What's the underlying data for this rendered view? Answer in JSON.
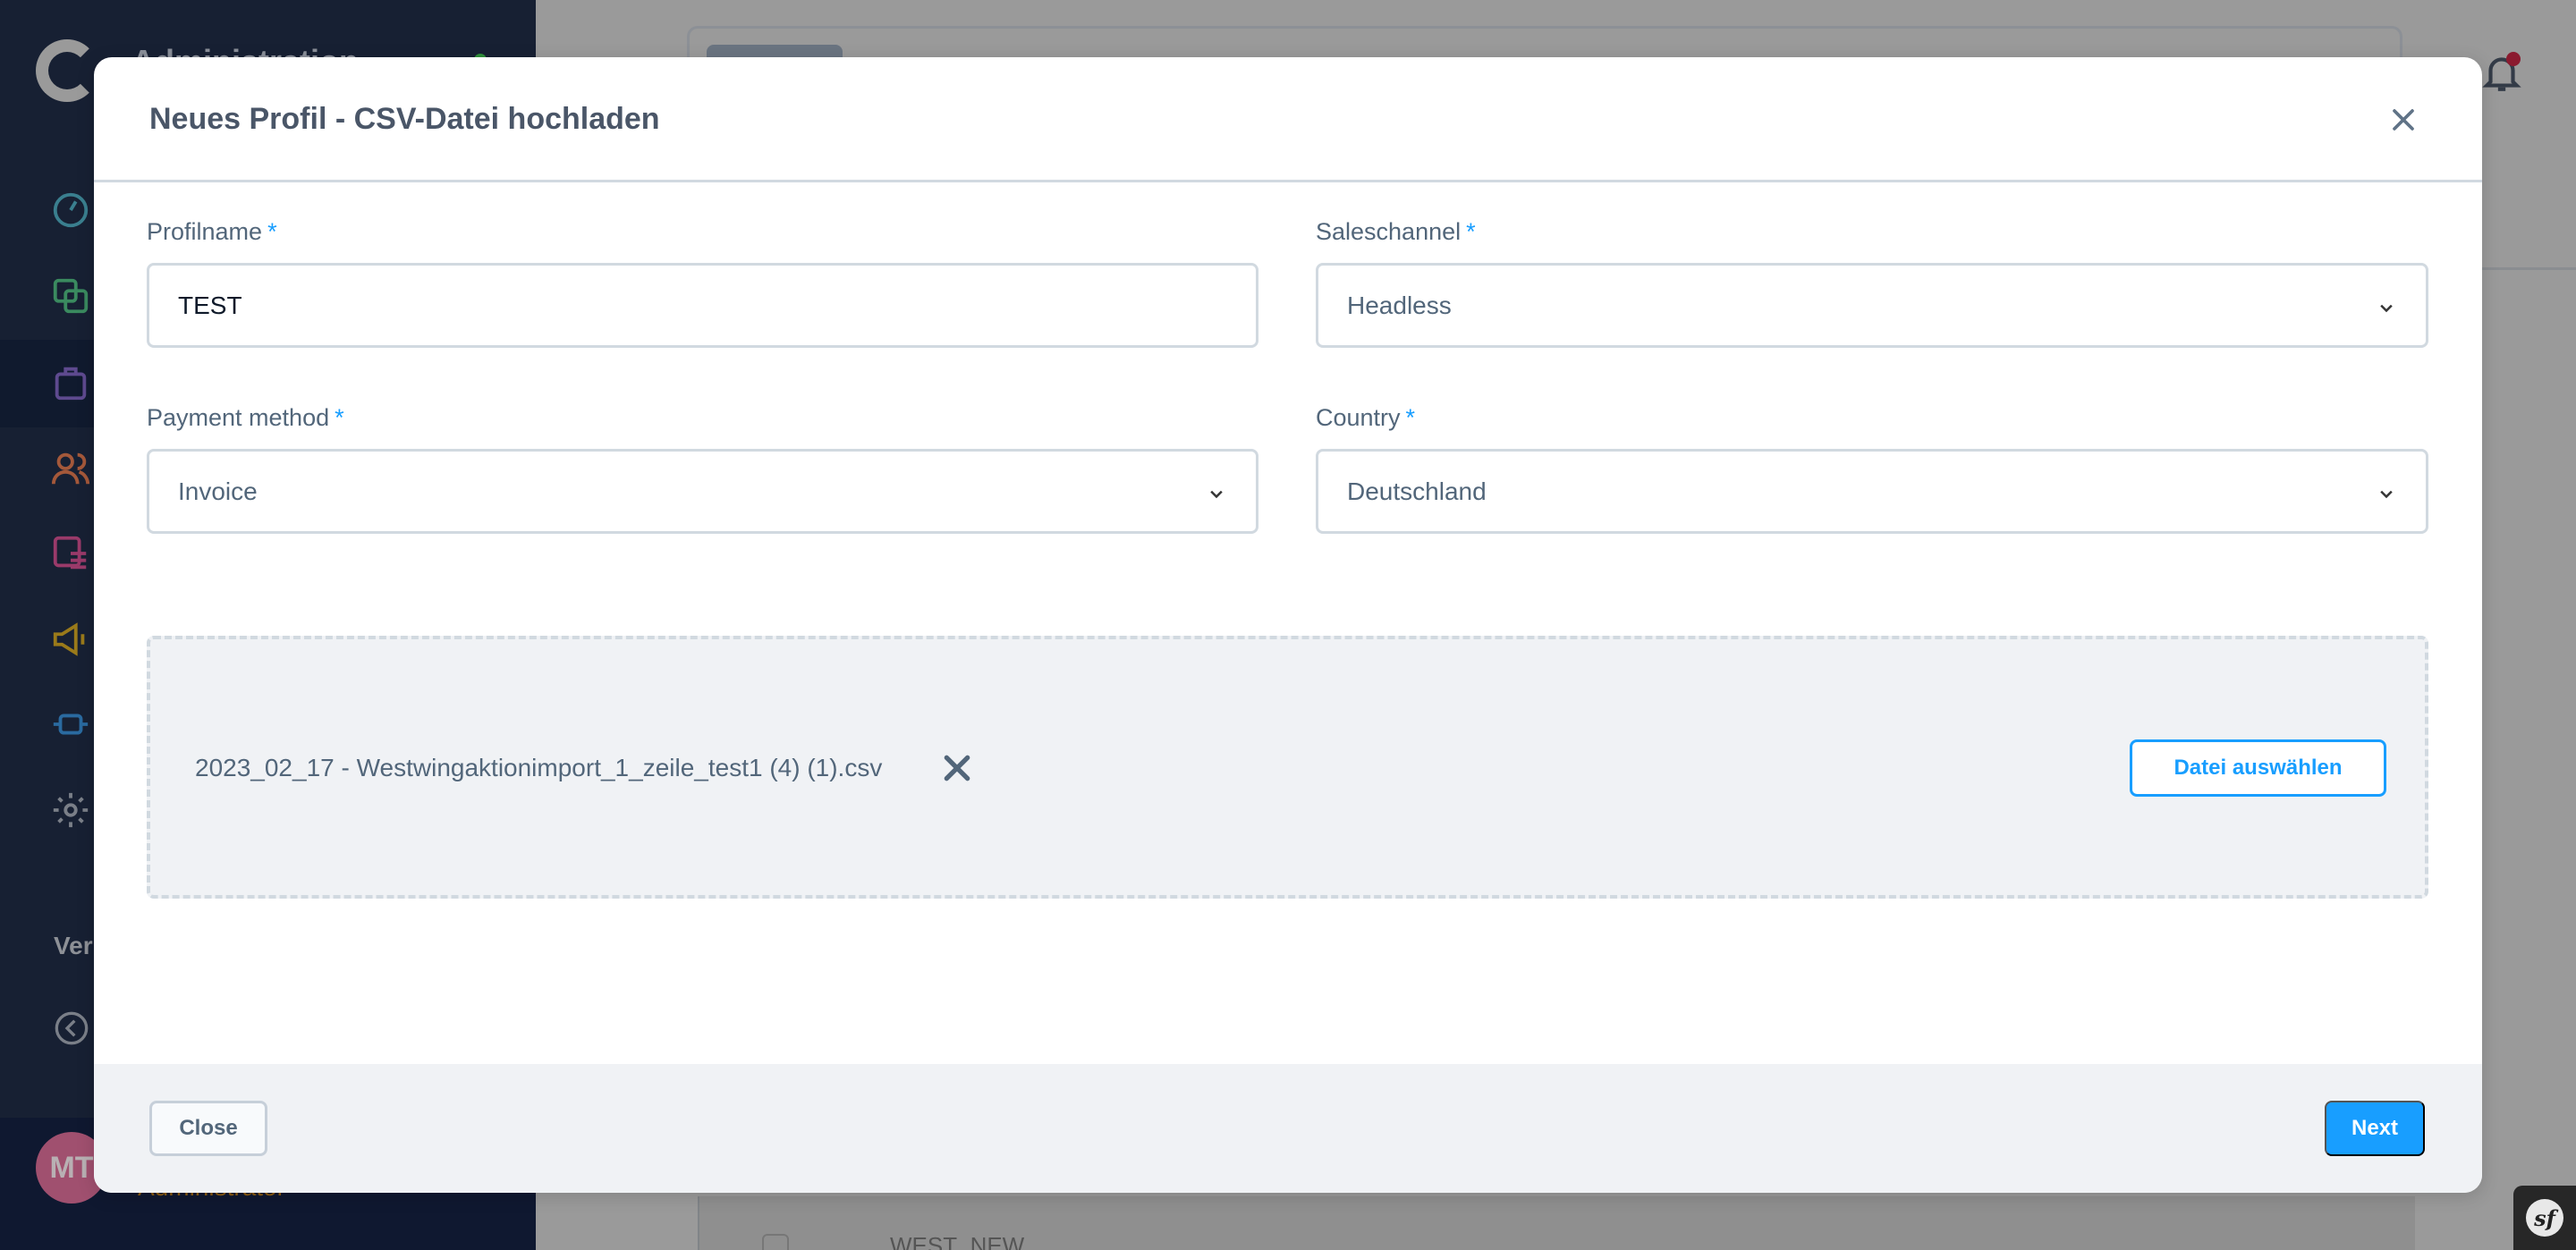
{
  "background": {
    "sidebar": {
      "title": "Administration",
      "nav_icons": [
        "dashboard-icon",
        "catalog-icon",
        "orders-icon",
        "customers-icon",
        "content-icon",
        "marketing-icon",
        "extensions-icon",
        "settings-icon"
      ],
      "section_label_partial": "Ver",
      "collapse_icon": "chevron-left-circle-icon",
      "user_initials": "MT",
      "user_role": "Administrator"
    },
    "table_row_partial": "WEST_NEW",
    "notification_icon": "bell-icon"
  },
  "modal": {
    "title": "Neues Profil - CSV-Datei hochladen",
    "close_icon": "close-icon",
    "required_marker": "*",
    "fields": {
      "profile_name": {
        "label": "Profilname",
        "value": "TEST"
      },
      "sales_channel": {
        "label": "Saleschannel",
        "value": "Headless"
      },
      "payment_method": {
        "label": "Payment method",
        "value": "Invoice"
      },
      "country": {
        "label": "Country",
        "value": "Deutschland"
      }
    },
    "upload": {
      "file_name": "2023_02_17 - Westwingaktionimport_1_zeile_test1 (4) (1).csv",
      "choose_file_label": "Datei auswählen"
    },
    "footer": {
      "close_label": "Close",
      "next_label": "Next"
    }
  },
  "colors": {
    "accent": "#189eff",
    "sidebar": "#172033",
    "text": "#52667a",
    "border": "#d1d9e0"
  }
}
